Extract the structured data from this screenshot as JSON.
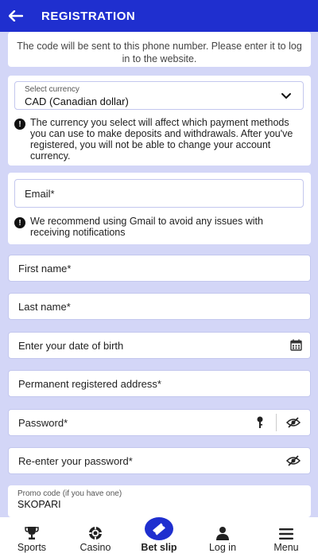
{
  "header": {
    "title": "REGISTRATION"
  },
  "phone_note": "The code will be sent to this phone number. Please enter it to log in to the website.",
  "currency": {
    "label": "Select currency",
    "value": "CAD  (Canadian dollar)",
    "info": "The currency you select will affect which payment methods you can use to make deposits and withdrawals. After you've registered, you will not be able to change your account currency."
  },
  "email": {
    "label": "Email*",
    "info": "We recommend using Gmail to avoid any issues with receiving notifications"
  },
  "fields": {
    "first_name": "First name*",
    "last_name": "Last name*",
    "dob": "Enter your date of birth",
    "address": "Permanent registered address*",
    "password": "Password*",
    "password_repeat": "Re-enter your password*"
  },
  "promo": {
    "label": "Promo code (if you have one)",
    "value": "SKOPARI"
  },
  "nav": {
    "sports": "Sports",
    "casino": "Casino",
    "betslip": "Bet slip",
    "login": "Log in",
    "menu": "Menu"
  },
  "colors": {
    "brand": "#1f2fcf",
    "background": "#d3d6f7"
  }
}
